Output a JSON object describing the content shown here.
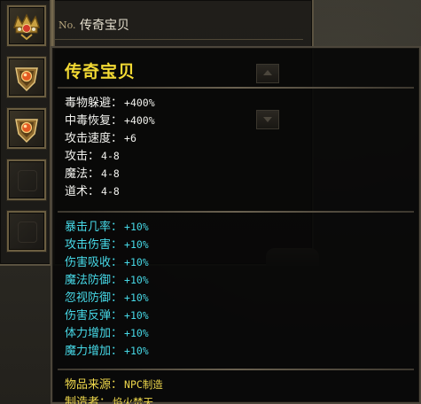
{
  "inventory": {
    "item_no_prefix": "No.",
    "item_name": "传奇宝贝",
    "slots": [
      {
        "icon": "crown-jewel-icon"
      },
      {
        "icon": "orb-shield-icon"
      },
      {
        "icon": "orb-shield-icon"
      },
      {
        "icon": "empty-slot-icon"
      },
      {
        "icon": "empty-slot-icon"
      }
    ]
  },
  "tooltip": {
    "title": "传奇宝贝",
    "base_stats": [
      {
        "label": "毒物躲避：",
        "value": "+400%"
      },
      {
        "label": "中毒恢复：",
        "value": "+400%"
      },
      {
        "label": "攻击速度：",
        "value": "+6"
      },
      {
        "label": "攻击：",
        "value": "4-8"
      },
      {
        "label": "魔法：",
        "value": "4-8"
      },
      {
        "label": "道术：",
        "value": "4-8"
      }
    ],
    "bonus_stats": [
      {
        "label": "暴击几率：",
        "value": "+10%"
      },
      {
        "label": "攻击伤害：",
        "value": "+10%"
      },
      {
        "label": "伤害吸收：",
        "value": "+10%"
      },
      {
        "label": "魔法防御：",
        "value": "+10%"
      },
      {
        "label": "忽视防御：",
        "value": "+10%"
      },
      {
        "label": "伤害反弹：",
        "value": "+10%"
      },
      {
        "label": "体力增加：",
        "value": "+10%"
      },
      {
        "label": "魔力增加：",
        "value": "+10%"
      }
    ],
    "info_lines": [
      {
        "label": "物品来源：",
        "value": "NPC制造"
      },
      {
        "label": "制造者：",
        "value": "焰火焚天"
      }
    ]
  },
  "colors": {
    "title": "#f3da34",
    "base_stat": "#f2f2ee",
    "bonus_stat": "#46d8e6",
    "info": "#efd84c"
  }
}
